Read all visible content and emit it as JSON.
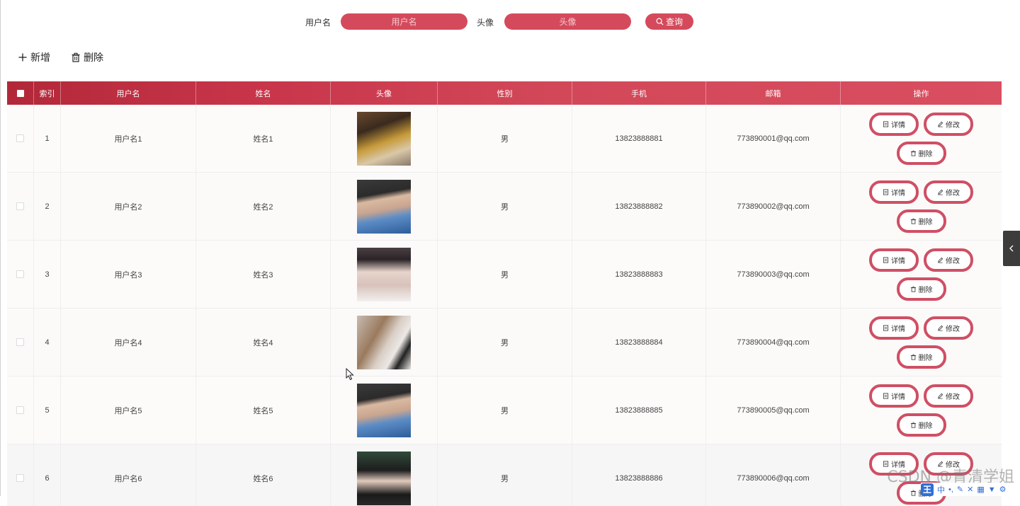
{
  "search": {
    "username_label": "用户名",
    "username_placeholder": "用户名",
    "avatar_label": "头像",
    "avatar_placeholder": "头像",
    "query_button": "查询"
  },
  "toolbar": {
    "add_label": "新增",
    "delete_label": "删除"
  },
  "table": {
    "columns": [
      "索引",
      "用户名",
      "姓名",
      "头像",
      "性别",
      "手机",
      "邮箱",
      "操作"
    ],
    "rows": [
      {
        "index": "1",
        "username": "用户名1",
        "name": "姓名1",
        "gender": "男",
        "phone": "13823888881",
        "email": "773890001@qq.com"
      },
      {
        "index": "2",
        "username": "用户名2",
        "name": "姓名2",
        "gender": "男",
        "phone": "13823888882",
        "email": "773890002@qq.com"
      },
      {
        "index": "3",
        "username": "用户名3",
        "name": "姓名3",
        "gender": "男",
        "phone": "13823888883",
        "email": "773890003@qq.com"
      },
      {
        "index": "4",
        "username": "用户名4",
        "name": "姓名4",
        "gender": "男",
        "phone": "13823888884",
        "email": "773890004@qq.com"
      },
      {
        "index": "5",
        "username": "用户名5",
        "name": "姓名5",
        "gender": "男",
        "phone": "13823888885",
        "email": "773890005@qq.com"
      },
      {
        "index": "6",
        "username": "用户名6",
        "name": "姓名6",
        "gender": "男",
        "phone": "13823888886",
        "email": "773890006@qq.com"
      }
    ],
    "actions": {
      "detail": "详情",
      "edit": "修改",
      "delete": "删除"
    }
  },
  "overlay": {
    "watermark": "CSDN @青清学姐",
    "ime_logo": "王",
    "ime_mode": "中"
  },
  "colors": {
    "accent": "#d44a5c",
    "header_start": "#b22839",
    "header_end": "#d94e60",
    "button_border": "#cf4f64"
  }
}
